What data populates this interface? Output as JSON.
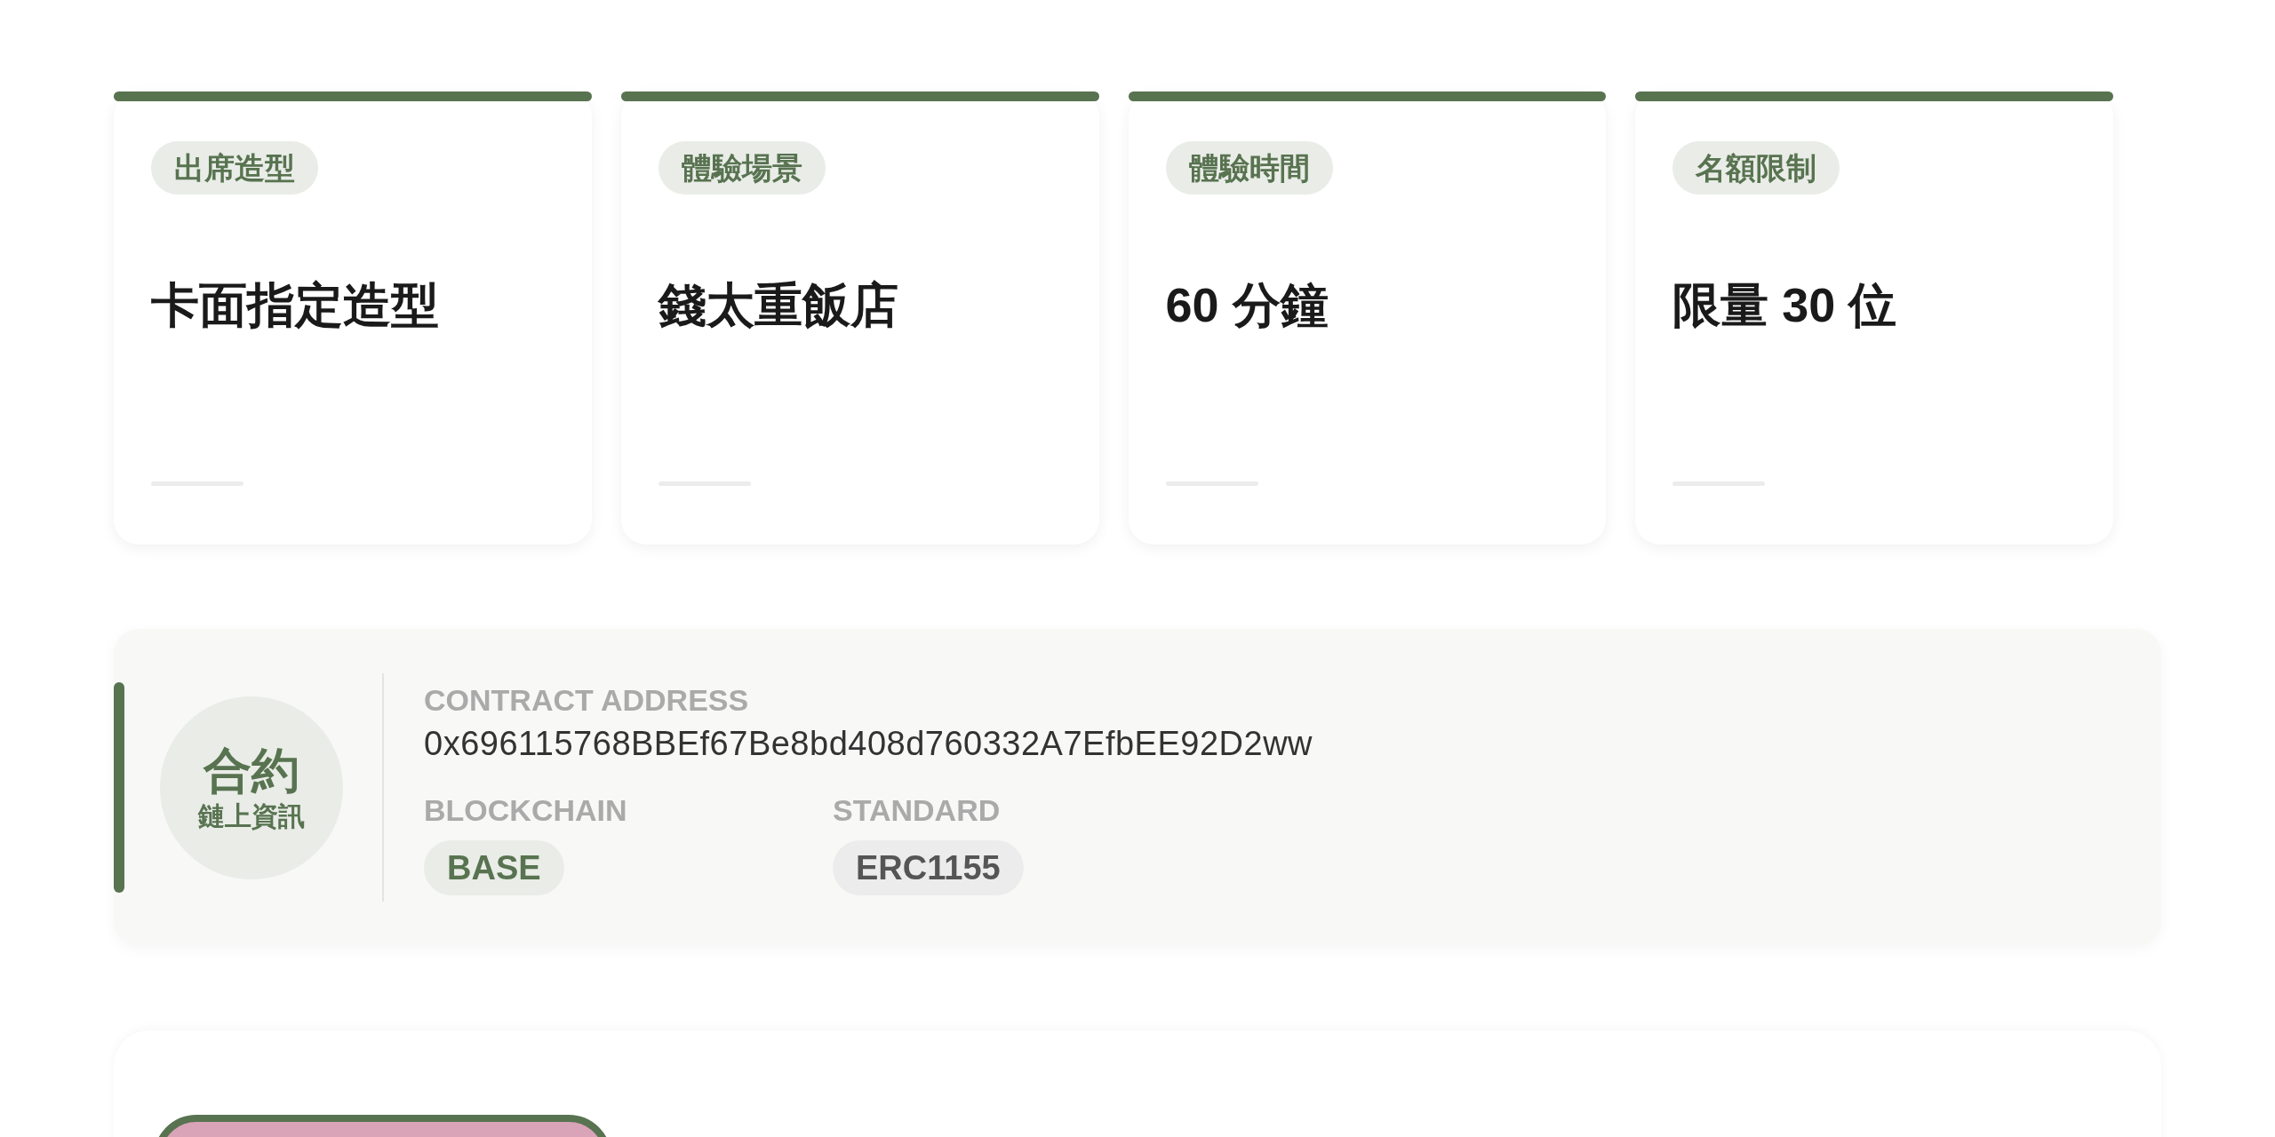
{
  "info_cards": [
    {
      "tag": "出席造型",
      "value": "卡面指定造型"
    },
    {
      "tag": "體驗場景",
      "value": "錢太重飯店"
    },
    {
      "tag": "體驗時間",
      "value": "60 分鐘"
    },
    {
      "tag": "名額限制",
      "value": "限量 30 位"
    }
  ],
  "contract": {
    "badge_title": "合約",
    "badge_subtitle": "鏈上資訊",
    "address_label": "CONTRACT ADDRESS",
    "address": "0x696115768BBEf67Be8bd408d760332A7EfbEE92D2ww",
    "fields": [
      {
        "label": "BLOCKCHAIN",
        "value": "BASE",
        "kind": "accent"
      },
      {
        "label": "STANDARD",
        "value": "ERC1155",
        "kind": "neutral"
      }
    ]
  }
}
